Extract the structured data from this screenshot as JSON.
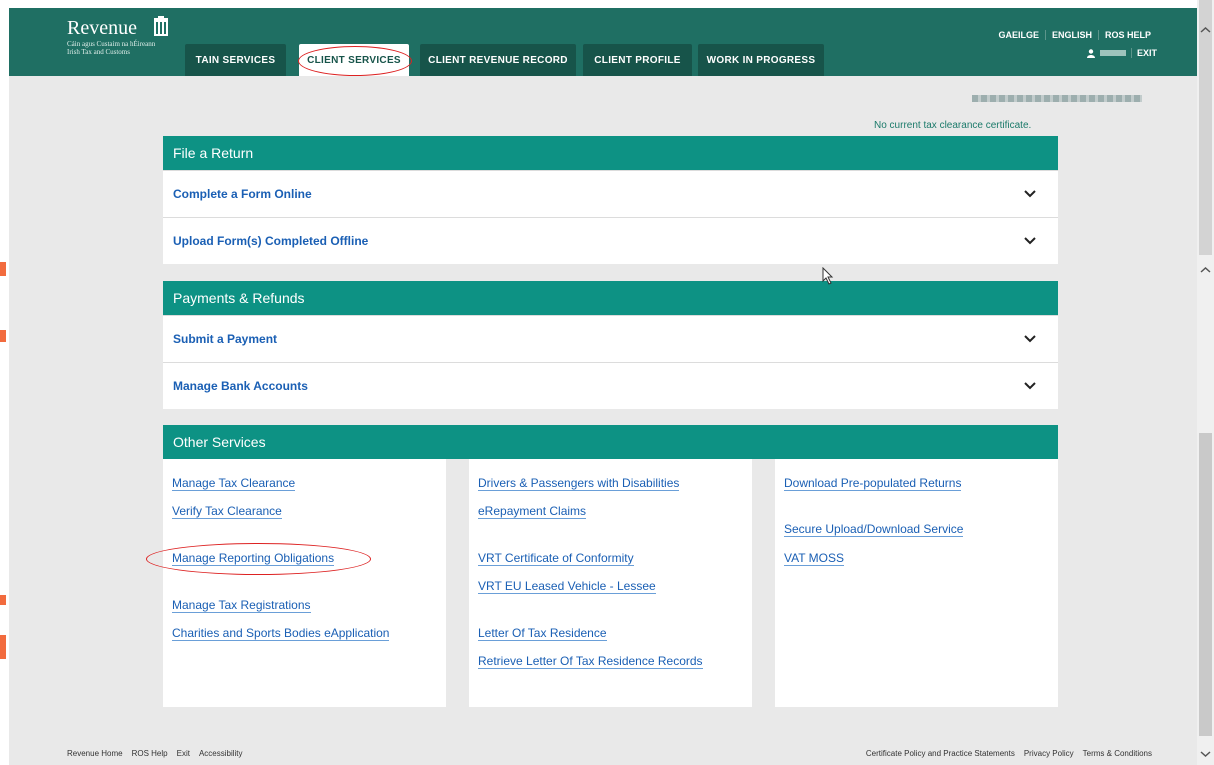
{
  "header": {
    "logo_name": "Revenue",
    "logo_sub1": "Cáin agus Custaim na hÉireann",
    "logo_sub2": "Irish Tax and Customs",
    "tabs": [
      {
        "label": "TAIN SERVICES"
      },
      {
        "label": "CLIENT SERVICES"
      },
      {
        "label": "CLIENT REVENUE RECORD"
      },
      {
        "label": "CLIENT PROFILE"
      },
      {
        "label": "WORK IN PROGRESS"
      }
    ],
    "links": {
      "gaeilge": "GAEILGE",
      "english": "ENGLISH",
      "ros_help": "ROS HELP",
      "exit": "EXIT"
    }
  },
  "info": {
    "tax_clearance_note": "No current tax clearance certificate."
  },
  "file_a_return": {
    "title": "File a Return",
    "rows": [
      {
        "label": "Complete a Form Online"
      },
      {
        "label": "Upload Form(s) Completed Offline"
      }
    ]
  },
  "payments": {
    "title": "Payments & Refunds",
    "rows": [
      {
        "label": "Submit a Payment"
      },
      {
        "label": "Manage Bank Accounts"
      }
    ]
  },
  "other": {
    "title": "Other Services",
    "col1": [
      "Manage Tax Clearance",
      "Verify Tax Clearance",
      "Manage Reporting Obligations",
      "Manage Tax Registrations",
      "Charities and Sports Bodies eApplication"
    ],
    "col2": [
      "Drivers & Passengers with Disabilities",
      "eRepayment Claims",
      "VRT Certificate of Conformity",
      "VRT EU Leased Vehicle - Lessee",
      "Letter Of Tax Residence",
      "Retrieve Letter Of Tax Residence Records"
    ],
    "col3": [
      "Download Pre-populated Returns",
      "Secure Upload/Download Service",
      "VAT MOSS"
    ]
  },
  "footer": {
    "left": [
      "Revenue Home",
      "ROS Help",
      "Exit",
      "Accessibility"
    ],
    "right": [
      "Certificate Policy and Practice Statements",
      "Privacy Policy",
      "Terms & Conditions"
    ]
  },
  "colors": {
    "header": "#1f6f63",
    "panel_head": "#0d9284",
    "link": "#1a5fb4",
    "highlight_ring": "#dd2222"
  }
}
